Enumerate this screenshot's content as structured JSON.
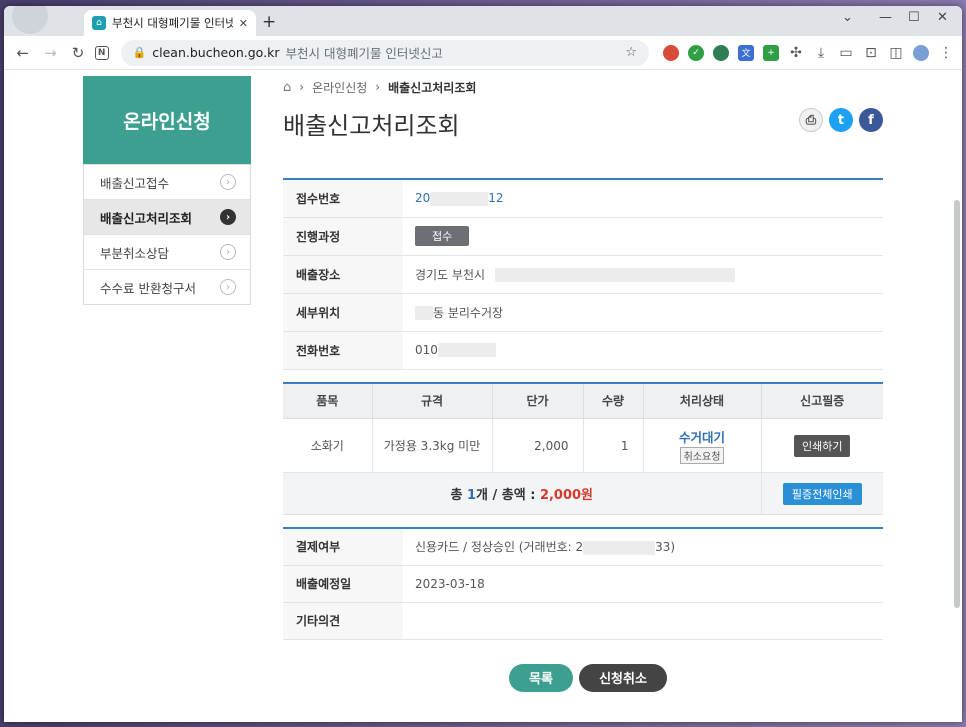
{
  "browser": {
    "tab_title": "부천시 대형폐기물 인터넷신고",
    "tab_close": "✕",
    "new_tab": "+",
    "url_domain": "clean.bucheon.go.kr",
    "url_page_title": "부천시 대형폐기물 인터넷신고",
    "window_controls": [
      "⌄",
      "—",
      "☐",
      "✕"
    ]
  },
  "sidebar": {
    "title": "온라인신청",
    "items": [
      {
        "label": "배출신고접수",
        "active": false
      },
      {
        "label": "배출신고처리조회",
        "active": true
      },
      {
        "label": "부분취소상담",
        "active": false
      },
      {
        "label": "수수료 반환청구서",
        "active": false
      }
    ]
  },
  "breadcrumb": {
    "items": [
      "온라인신청",
      "배출신고처리조회"
    ]
  },
  "page_title": "배출신고처리조회",
  "info": {
    "receipt_no_label": "접수번호",
    "receipt_no_prefix": "20",
    "receipt_no_suffix": "12",
    "progress_label": "진행과정",
    "progress_value": "접수",
    "place_label": "배출장소",
    "place_value": "경기도 부천시",
    "detail_label": "세부위치",
    "detail_value": "동 분리수거장",
    "phone_label": "전화번호",
    "phone_prefix": "010"
  },
  "items_table": {
    "headers": [
      "품목",
      "규격",
      "단가",
      "수량",
      "처리상태",
      "신고필증"
    ],
    "rows": [
      {
        "item": "소화기",
        "spec": "가정용 3.3kg 미만",
        "price": "2,000",
        "qty": "1",
        "status": "수거대기",
        "cancel_request": "취소요청",
        "certificate": "인쇄하기"
      }
    ],
    "total_prefix": "총 ",
    "total_count": "1",
    "total_mid": "개 / 총액 : ",
    "total_amount": "2,000원",
    "print_all": "필증전체인쇄"
  },
  "payment": {
    "pay_label": "결제여부",
    "pay_value_prefix": "신용카드 / 정상승인 (거래번호: 2",
    "pay_value_suffix": "33)",
    "date_label": "배출예정일",
    "date_value": "2023-03-18",
    "note_label": "기타의견",
    "note_value": ""
  },
  "buttons": {
    "list": "목록",
    "cancel": "신청취소"
  }
}
